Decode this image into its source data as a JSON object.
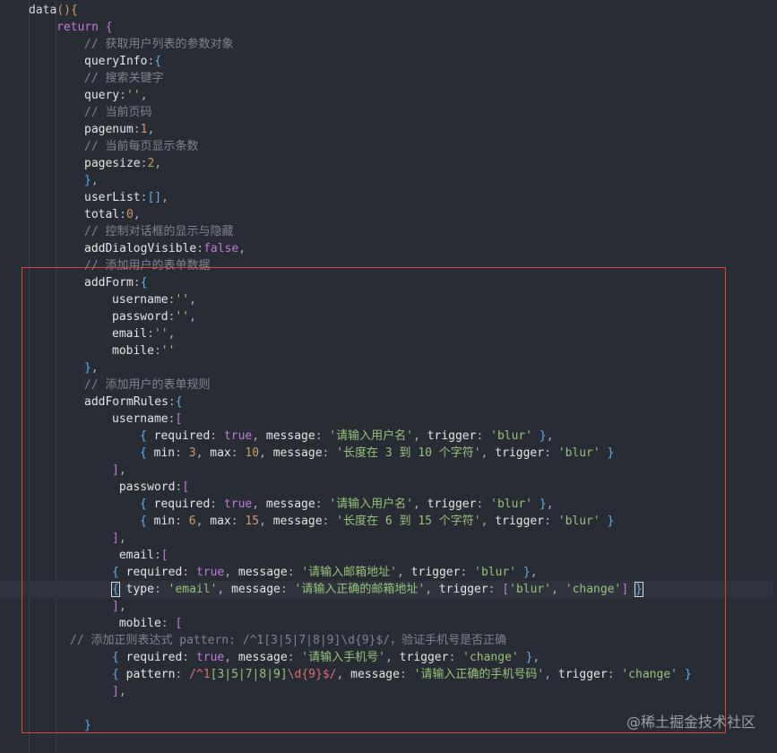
{
  "code_lines": [
    {
      "indent": 0,
      "tokens": [
        [
          "fn",
          "data"
        ],
        [
          "br",
          "()"
        ],
        [
          "br",
          "{"
        ]
      ]
    },
    {
      "indent": 1,
      "tokens": [
        [
          "kw",
          "return"
        ],
        [
          "pun",
          " "
        ],
        [
          "br2",
          "{"
        ]
      ]
    },
    {
      "indent": 2,
      "tokens": [
        [
          "com",
          "// 获取用户列表的参数对象"
        ]
      ]
    },
    {
      "indent": 2,
      "tokens": [
        [
          "prop",
          "queryInfo"
        ],
        [
          "pun",
          ":"
        ],
        [
          "br3",
          "{"
        ]
      ]
    },
    {
      "indent": 2,
      "tokens": [
        [
          "com",
          "// 搜索关键字"
        ]
      ]
    },
    {
      "indent": 2,
      "tokens": [
        [
          "prop",
          "query"
        ],
        [
          "pun",
          ":"
        ],
        [
          "str",
          "''"
        ],
        [
          "pun",
          ","
        ]
      ]
    },
    {
      "indent": 2,
      "tokens": [
        [
          "com",
          "// 当前页码"
        ]
      ]
    },
    {
      "indent": 2,
      "tokens": [
        [
          "prop",
          "pagenum"
        ],
        [
          "pun",
          ":"
        ],
        [
          "num",
          "1"
        ],
        [
          "pun",
          ","
        ]
      ]
    },
    {
      "indent": 2,
      "tokens": [
        [
          "com",
          "// 当前每页显示条数"
        ]
      ]
    },
    {
      "indent": 2,
      "tokens": [
        [
          "prop",
          "pagesize"
        ],
        [
          "pun",
          ":"
        ],
        [
          "num",
          "2"
        ],
        [
          "pun",
          ","
        ]
      ]
    },
    {
      "indent": 2,
      "tokens": [
        [
          "br3",
          "}"
        ],
        [
          "pun",
          ","
        ]
      ]
    },
    {
      "indent": 2,
      "tokens": [
        [
          "prop",
          "userList"
        ],
        [
          "pun",
          ":"
        ],
        [
          "br3",
          "[]"
        ],
        [
          "pun",
          ","
        ]
      ]
    },
    {
      "indent": 2,
      "tokens": [
        [
          "prop",
          "total"
        ],
        [
          "pun",
          ":"
        ],
        [
          "num",
          "0"
        ],
        [
          "pun",
          ","
        ]
      ]
    },
    {
      "indent": 2,
      "tokens": [
        [
          "com",
          "// 控制对话框的显示与隐藏"
        ]
      ]
    },
    {
      "indent": 2,
      "tokens": [
        [
          "prop",
          "addDialogVisible"
        ],
        [
          "pun",
          ":"
        ],
        [
          "bool",
          "false"
        ],
        [
          "pun",
          ","
        ]
      ]
    },
    {
      "indent": 2,
      "tokens": [
        [
          "com",
          "// 添加用户的表单数据"
        ]
      ]
    },
    {
      "indent": 2,
      "tokens": [
        [
          "prop",
          "addForm"
        ],
        [
          "pun",
          ":"
        ],
        [
          "br3",
          "{"
        ]
      ]
    },
    {
      "indent": 3,
      "tokens": [
        [
          "prop",
          "username"
        ],
        [
          "pun",
          ":"
        ],
        [
          "str",
          "''"
        ],
        [
          "pun",
          ","
        ]
      ]
    },
    {
      "indent": 3,
      "tokens": [
        [
          "prop",
          "password"
        ],
        [
          "pun",
          ":"
        ],
        [
          "str",
          "''"
        ],
        [
          "pun",
          ","
        ]
      ]
    },
    {
      "indent": 3,
      "tokens": [
        [
          "prop",
          "email"
        ],
        [
          "pun",
          ":"
        ],
        [
          "str",
          "''"
        ],
        [
          "pun",
          ","
        ]
      ]
    },
    {
      "indent": 3,
      "tokens": [
        [
          "prop",
          "mobile"
        ],
        [
          "pun",
          ":"
        ],
        [
          "str",
          "''"
        ]
      ]
    },
    {
      "indent": 2,
      "tokens": [
        [
          "br3",
          "}"
        ],
        [
          "pun",
          ","
        ]
      ]
    },
    {
      "indent": 2,
      "tokens": [
        [
          "com",
          "// 添加用户的表单规则"
        ]
      ]
    },
    {
      "indent": 2,
      "tokens": [
        [
          "prop",
          "addFormRules"
        ],
        [
          "pun",
          ":"
        ],
        [
          "br3",
          "{"
        ]
      ]
    },
    {
      "indent": 3,
      "tokens": [
        [
          "prop",
          "username"
        ],
        [
          "pun",
          ":"
        ],
        [
          "br2",
          "["
        ]
      ]
    },
    {
      "indent": 4,
      "tokens": [
        [
          "br3",
          "{"
        ],
        [
          "pun",
          " "
        ],
        [
          "prop",
          "required"
        ],
        [
          "pun",
          ": "
        ],
        [
          "bool",
          "true"
        ],
        [
          "pun",
          ", "
        ],
        [
          "prop",
          "message"
        ],
        [
          "pun",
          ": "
        ],
        [
          "str",
          "'请输入用户名'"
        ],
        [
          "pun",
          ", "
        ],
        [
          "prop",
          "trigger"
        ],
        [
          "pun",
          ": "
        ],
        [
          "str",
          "'blur'"
        ],
        [
          "pun",
          " "
        ],
        [
          "br3",
          "}"
        ],
        [
          "pun",
          ","
        ]
      ]
    },
    {
      "indent": 4,
      "tokens": [
        [
          "br3",
          "{"
        ],
        [
          "pun",
          " "
        ],
        [
          "prop",
          "min"
        ],
        [
          "pun",
          ": "
        ],
        [
          "num",
          "3"
        ],
        [
          "pun",
          ", "
        ],
        [
          "prop",
          "max"
        ],
        [
          "pun",
          ": "
        ],
        [
          "num",
          "10"
        ],
        [
          "pun",
          ", "
        ],
        [
          "prop",
          "message"
        ],
        [
          "pun",
          ": "
        ],
        [
          "str",
          "'长度在 3 到 10 个字符'"
        ],
        [
          "pun",
          ", "
        ],
        [
          "prop",
          "trigger"
        ],
        [
          "pun",
          ": "
        ],
        [
          "str",
          "'blur'"
        ],
        [
          "pun",
          " "
        ],
        [
          "br3",
          "}"
        ]
      ]
    },
    {
      "indent": 3,
      "tokens": [
        [
          "br2",
          "]"
        ],
        [
          "pun",
          ","
        ]
      ]
    },
    {
      "indent": 3,
      "extra": " ",
      "tokens": [
        [
          "prop",
          "password"
        ],
        [
          "pun",
          ":"
        ],
        [
          "br2",
          "["
        ]
      ]
    },
    {
      "indent": 4,
      "tokens": [
        [
          "br3",
          "{"
        ],
        [
          "pun",
          " "
        ],
        [
          "prop",
          "required"
        ],
        [
          "pun",
          ": "
        ],
        [
          "bool",
          "true"
        ],
        [
          "pun",
          ", "
        ],
        [
          "prop",
          "message"
        ],
        [
          "pun",
          ": "
        ],
        [
          "str",
          "'请输入用户名'"
        ],
        [
          "pun",
          ", "
        ],
        [
          "prop",
          "trigger"
        ],
        [
          "pun",
          ": "
        ],
        [
          "str",
          "'blur'"
        ],
        [
          "pun",
          " "
        ],
        [
          "br3",
          "}"
        ],
        [
          "pun",
          ","
        ]
      ]
    },
    {
      "indent": 4,
      "tokens": [
        [
          "br3",
          "{"
        ],
        [
          "pun",
          " "
        ],
        [
          "prop",
          "min"
        ],
        [
          "pun",
          ": "
        ],
        [
          "num",
          "6"
        ],
        [
          "pun",
          ", "
        ],
        [
          "prop",
          "max"
        ],
        [
          "pun",
          ": "
        ],
        [
          "num",
          "15"
        ],
        [
          "pun",
          ", "
        ],
        [
          "prop",
          "message"
        ],
        [
          "pun",
          ": "
        ],
        [
          "str",
          "'长度在 6 到 15 个字符'"
        ],
        [
          "pun",
          ", "
        ],
        [
          "prop",
          "trigger"
        ],
        [
          "pun",
          ": "
        ],
        [
          "str",
          "'blur'"
        ],
        [
          "pun",
          " "
        ],
        [
          "br3",
          "}"
        ]
      ]
    },
    {
      "indent": 3,
      "tokens": [
        [
          "br2",
          "]"
        ],
        [
          "pun",
          ","
        ]
      ]
    },
    {
      "indent": 3,
      "extra": " ",
      "tokens": [
        [
          "prop",
          "email"
        ],
        [
          "pun",
          ":"
        ],
        [
          "br2",
          "["
        ]
      ]
    },
    {
      "indent": 3,
      "tokens": [
        [
          "br3",
          "{"
        ],
        [
          "pun",
          " "
        ],
        [
          "prop",
          "required"
        ],
        [
          "pun",
          ": "
        ],
        [
          "bool",
          "true"
        ],
        [
          "pun",
          ", "
        ],
        [
          "prop",
          "message"
        ],
        [
          "pun",
          ": "
        ],
        [
          "str",
          "'请输入邮箱地址'"
        ],
        [
          "pun",
          ", "
        ],
        [
          "prop",
          "trigger"
        ],
        [
          "pun",
          ": "
        ],
        [
          "str",
          "'blur'"
        ],
        [
          "pun",
          " "
        ],
        [
          "br3",
          "}"
        ],
        [
          "pun",
          ","
        ]
      ]
    },
    {
      "indent": 3,
      "current": true,
      "tokens": [
        [
          "br3",
          "{"
        ],
        [
          "pun",
          " "
        ],
        [
          "prop",
          "type"
        ],
        [
          "pun",
          ": "
        ],
        [
          "str",
          "'email'"
        ],
        [
          "pun",
          ", "
        ],
        [
          "prop",
          "message"
        ],
        [
          "pun",
          ": "
        ],
        [
          "str",
          "'请输入正确的邮箱地址'"
        ],
        [
          "pun",
          ", "
        ],
        [
          "prop",
          "trigger"
        ],
        [
          "pun",
          ": "
        ],
        [
          "br2",
          "["
        ],
        [
          "str",
          "'blur'"
        ],
        [
          "pun",
          ", "
        ],
        [
          "str",
          "'change'"
        ],
        [
          "br2",
          "]"
        ],
        [
          "pun",
          " "
        ],
        [
          "br3",
          "}"
        ]
      ]
    },
    {
      "indent": 3,
      "tokens": [
        [
          "br2",
          "]"
        ],
        [
          "pun",
          ","
        ]
      ]
    },
    {
      "indent": 3,
      "extra": " ",
      "tokens": [
        [
          "prop",
          "mobile"
        ],
        [
          "pun",
          ": "
        ],
        [
          "br2",
          "["
        ]
      ]
    },
    {
      "indent": 0,
      "extra": "  ",
      "tokens": [
        [
          "com",
          "// 添加正则表达式 pattern: /^1[3|5|7|8|9]\\d{9}$/，验证手机号是否正确"
        ]
      ]
    },
    {
      "indent": 3,
      "tokens": [
        [
          "br3",
          "{"
        ],
        [
          "pun",
          " "
        ],
        [
          "prop",
          "required"
        ],
        [
          "pun",
          ": "
        ],
        [
          "bool",
          "true"
        ],
        [
          "pun",
          ", "
        ],
        [
          "prop",
          "message"
        ],
        [
          "pun",
          ": "
        ],
        [
          "str",
          "'请输入手机号'"
        ],
        [
          "pun",
          ", "
        ],
        [
          "prop",
          "trigger"
        ],
        [
          "pun",
          ": "
        ],
        [
          "str",
          "'change'"
        ],
        [
          "pun",
          " "
        ],
        [
          "br3",
          "}"
        ],
        [
          "pun",
          ","
        ]
      ]
    },
    {
      "indent": 3,
      "tokens": [
        [
          "br3",
          "{"
        ],
        [
          "pun",
          " "
        ],
        [
          "prop",
          "pattern"
        ],
        [
          "pun",
          ": "
        ],
        [
          "regex",
          "/^1"
        ],
        [
          "str",
          "[3|5|7|8|9]"
        ],
        [
          "regex",
          "\\d{9}$/"
        ],
        [
          "pun",
          ", "
        ],
        [
          "prop",
          "message"
        ],
        [
          "pun",
          ": "
        ],
        [
          "str",
          "'请输入正确的手机号码'"
        ],
        [
          "pun",
          ", "
        ],
        [
          "prop",
          "trigger"
        ],
        [
          "pun",
          ": "
        ],
        [
          "str",
          "'change'"
        ],
        [
          "pun",
          " "
        ],
        [
          "br3",
          "}"
        ]
      ]
    },
    {
      "indent": 3,
      "tokens": [
        [
          "br2",
          "]"
        ],
        [
          "pun",
          ","
        ]
      ]
    },
    {
      "indent": 3,
      "tokens": []
    },
    {
      "indent": 2,
      "tokens": [
        [
          "br3",
          "}"
        ]
      ]
    }
  ],
  "watermark": "@稀土掘金技术社区"
}
